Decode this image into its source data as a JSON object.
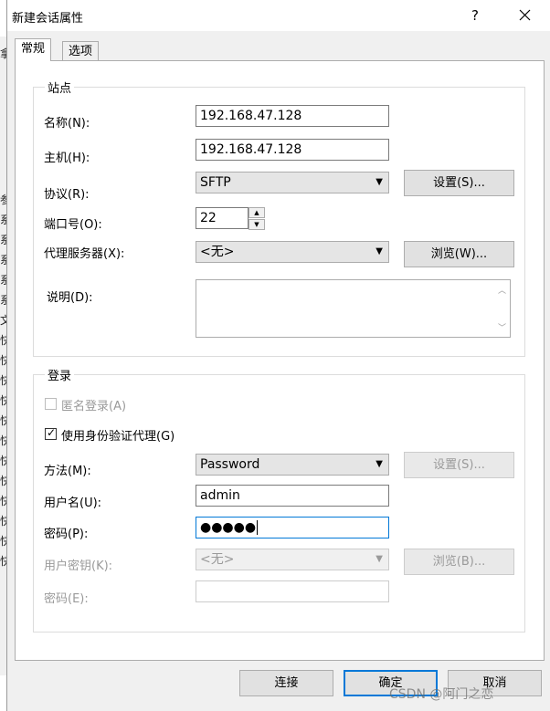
{
  "window": {
    "title": "新建会话属性",
    "help_label": "?"
  },
  "background_glyphs": [
    "拿",
    "参",
    "系",
    "系",
    "系",
    "系",
    "系",
    "文",
    "快",
    "快",
    "快",
    "快",
    "快",
    "快",
    "快",
    "快",
    "快",
    "快",
    "快",
    "快"
  ],
  "tabs": [
    {
      "label": "常规",
      "active": true
    },
    {
      "label": "选项",
      "active": false
    }
  ],
  "site_group": {
    "title": "站点",
    "name": {
      "label": "名称(N):",
      "value": "192.168.47.128"
    },
    "host": {
      "label": "主机(H):",
      "value": "192.168.47.128"
    },
    "protocol": {
      "label": "协议(R):",
      "value": "SFTP",
      "settings_button": "设置(S)..."
    },
    "port": {
      "label": "端口号(O):",
      "value": "22"
    },
    "proxy": {
      "label": "代理服务器(X):",
      "value": "<无>",
      "browse_button": "浏览(W)..."
    },
    "description": {
      "label": "说明(D):",
      "value": ""
    }
  },
  "login_group": {
    "title": "登录",
    "anonymous": {
      "label": "匿名登录(A)",
      "checked": false,
      "enabled": false
    },
    "use_agent": {
      "label": "使用身份验证代理(G)",
      "checked": true,
      "enabled": true
    },
    "method": {
      "label": "方法(M):",
      "value": "Password",
      "settings_button": "设置(S)..."
    },
    "username": {
      "label": "用户名(U):",
      "value": "admin"
    },
    "password": {
      "label": "密码(P):",
      "value": "●●●●●"
    },
    "user_key": {
      "label": "用户密钥(K):",
      "value": "<无>",
      "browse_button": "浏览(B)..."
    },
    "passphrase": {
      "label": "密码(E):",
      "value": ""
    }
  },
  "footer": {
    "connect_button": "连接",
    "ok_button": "确定",
    "cancel_button": "取消"
  },
  "watermark": "CSDN @阿门之恋",
  "colors": {
    "accent": "#0078d7",
    "dialog_bg": "#f0f0f0",
    "panel_bg": "#ffffff",
    "disabled_text": "#9a9a9a"
  }
}
